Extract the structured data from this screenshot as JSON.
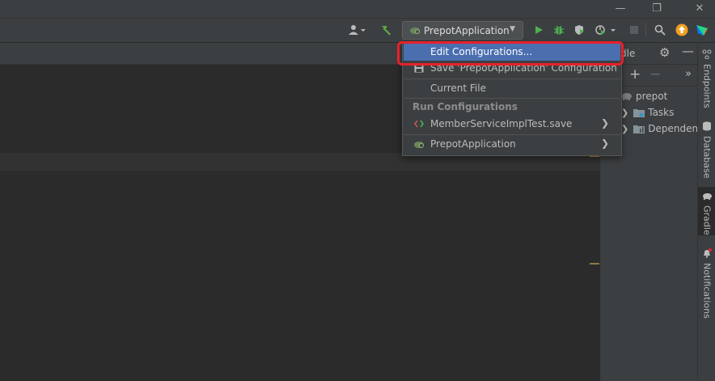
{
  "titlebar": {
    "minimize_icon": "minimize-icon",
    "restore_icon": "restore-icon",
    "close_icon": "close-icon"
  },
  "toolbar": {
    "run_config_selected": "PrepotApplication"
  },
  "dropdown": {
    "items": [
      {
        "label": "Edit Configurations...",
        "icon": null
      },
      {
        "label": "Save 'PrepotApplication' Configuration",
        "icon": "save-icon"
      },
      {
        "label": "Current File",
        "icon": null
      }
    ],
    "group_header": "Run Configurations",
    "run_configs": [
      {
        "label": "MemberServiceImplTest.save",
        "icon": "junit-icon"
      },
      {
        "label": "PrepotApplication",
        "icon": "spring-boot-icon"
      }
    ]
  },
  "gradle_panel": {
    "title_partial": "dle",
    "tree": [
      {
        "label": "prepot",
        "icon": "elephant-icon"
      },
      {
        "label": "Tasks",
        "icon": "folder-gear-icon"
      },
      {
        "label": "Dependencies",
        "icon": "folder-chart-icon"
      }
    ]
  },
  "right_stripe": {
    "tabs": [
      {
        "label": "Endpoints"
      },
      {
        "label": "Database"
      },
      {
        "label": "Gradle"
      },
      {
        "label": "Notifications"
      }
    ]
  },
  "colors": {
    "highlight_ring": "#e8202a",
    "menu_selected": "#4b6eaf",
    "run_green": "#4caf50"
  }
}
